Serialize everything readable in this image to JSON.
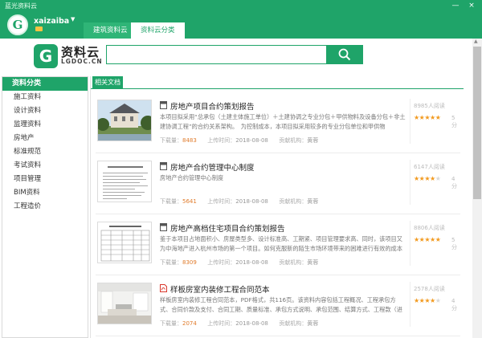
{
  "window": {
    "title": "蓝光资料云",
    "minimize": "—",
    "close": "×"
  },
  "user": {
    "avatar_letter": "G",
    "name": "xaizaiba",
    "dropdown": "▼"
  },
  "tabs": [
    {
      "label": "建筑资料云"
    },
    {
      "label": "资料云分类"
    }
  ],
  "logo": {
    "mark": "G",
    "name": "资料云",
    "sub": "LGDOC.CN"
  },
  "search": {
    "placeholder": ""
  },
  "sidebar": {
    "title": "资料分类",
    "items": [
      {
        "label": "施工资料"
      },
      {
        "label": "设计资料"
      },
      {
        "label": "监理资料"
      },
      {
        "label": "房地产"
      },
      {
        "label": "标准规范"
      },
      {
        "label": "考试资料"
      },
      {
        "label": "项目管理"
      },
      {
        "label": "BIM资料"
      },
      {
        "label": "工程造价"
      }
    ]
  },
  "main": {
    "tab_label": "相关文档"
  },
  "docs": [
    {
      "title": "房地产项目合约策划报告",
      "desc": "本项目拟采用“总承包（土建主体施工单位）＋土建协调之专业分包＋甲供物料及设备分包＋非土建协调工程”的合约关系架构。　为控制成本，本项目拟采用较多的专业分包单位和甲供物",
      "downloads_label": "下载量：",
      "downloads": "8483",
      "upload_label": "上传时间：",
      "upload": "2018-08-08",
      "contrib_label": "贡献机构：",
      "contrib": "黄蓉",
      "reads": "8985人阅读",
      "stars": "★★★★★",
      "stars_off": "",
      "score": "5 分"
    },
    {
      "title": "房地产合约管理中心制度",
      "desc": "房地产合约管理中心制度",
      "downloads_label": "下载量：",
      "downloads": "5641",
      "upload_label": "上传时间：",
      "upload": "2018-08-08",
      "contrib_label": "贡献机构：",
      "contrib": "黄蓉",
      "reads": "6147人阅读",
      "stars": "★★★★",
      "stars_off": "★",
      "score": "4 分"
    },
    {
      "title": "房地产高档住宅项目合约策划报告",
      "desc": "鉴于本项目占地面积小、房屋类型多、设计标准高、工期紧、项目管理要求高、同时，该项目又为中海地产进入杭州市场的第一个项目。如何克服新的陌生市场环境带来的困难进行有效的成本控",
      "downloads_label": "下载量：",
      "downloads": "8309",
      "upload_label": "上传时间：",
      "upload": "2018-08-08",
      "contrib_label": "贡献机构：",
      "contrib": "黄蓉",
      "reads": "8806人阅读",
      "stars": "★★★★★",
      "stars_off": "",
      "score": "5 分"
    },
    {
      "title": "样板房室内装修工程合同范本",
      "desc": "样板房室内装修工程合同范本，PDF格式，共116页。该资料内容包括工程概况、工程承包方式、合同价款及支付、合同工期、质量标准、承包方式说明、承包范围、结算方式、工程款（进",
      "downloads_label": "下载量：",
      "downloads": "2074",
      "upload_label": "上传时间：",
      "upload": "2018-08-08",
      "contrib_label": "贡献机构：",
      "contrib": "黄蓉",
      "reads": "2578人阅读",
      "stars": "★★★★",
      "stars_off": "★",
      "score": "4 分"
    }
  ],
  "colors": {
    "brand": "#1fa469",
    "star": "#f29a1f",
    "download": "#e07b2b"
  }
}
